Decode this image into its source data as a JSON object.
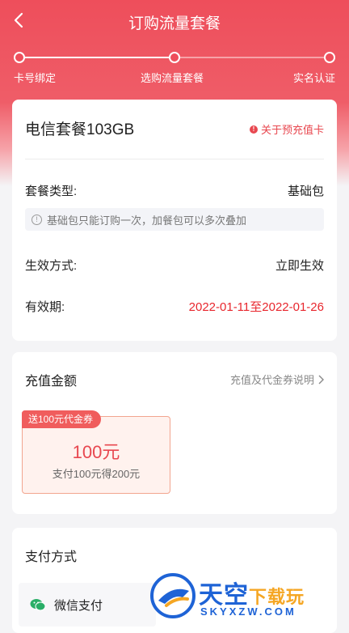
{
  "header": {
    "title": "订购流量套餐"
  },
  "steps": [
    {
      "label": "卡号绑定"
    },
    {
      "label": "选购流量套餐"
    },
    {
      "label": "实名认证"
    }
  ],
  "package": {
    "name": "电信套餐103GB",
    "about_link": "关于预充值卡",
    "type_label": "套餐类型:",
    "type_value": "基础包",
    "notice": "基础包只能订购一次，加餐包可以多次叠加",
    "effect_label": "生效方式:",
    "effect_value": "立即生效",
    "validity_label": "有效期:",
    "validity_value": "2022-01-11至2022-01-26"
  },
  "recharge": {
    "title": "充值金额",
    "link": "充值及代金券说明",
    "coupon_badge": "送100元代金券",
    "amount": "100元",
    "subtitle": "支付100元得200元"
  },
  "payment": {
    "title": "支付方式",
    "method": "微信支付"
  },
  "watermark": {
    "text_main": "天空",
    "text_accent": "下载玩",
    "text_url": "SKYXZW.COM"
  },
  "colors": {
    "brand": "#ee4e5b",
    "price_red": "#e8262d",
    "wechat_green": "#2aae67"
  }
}
